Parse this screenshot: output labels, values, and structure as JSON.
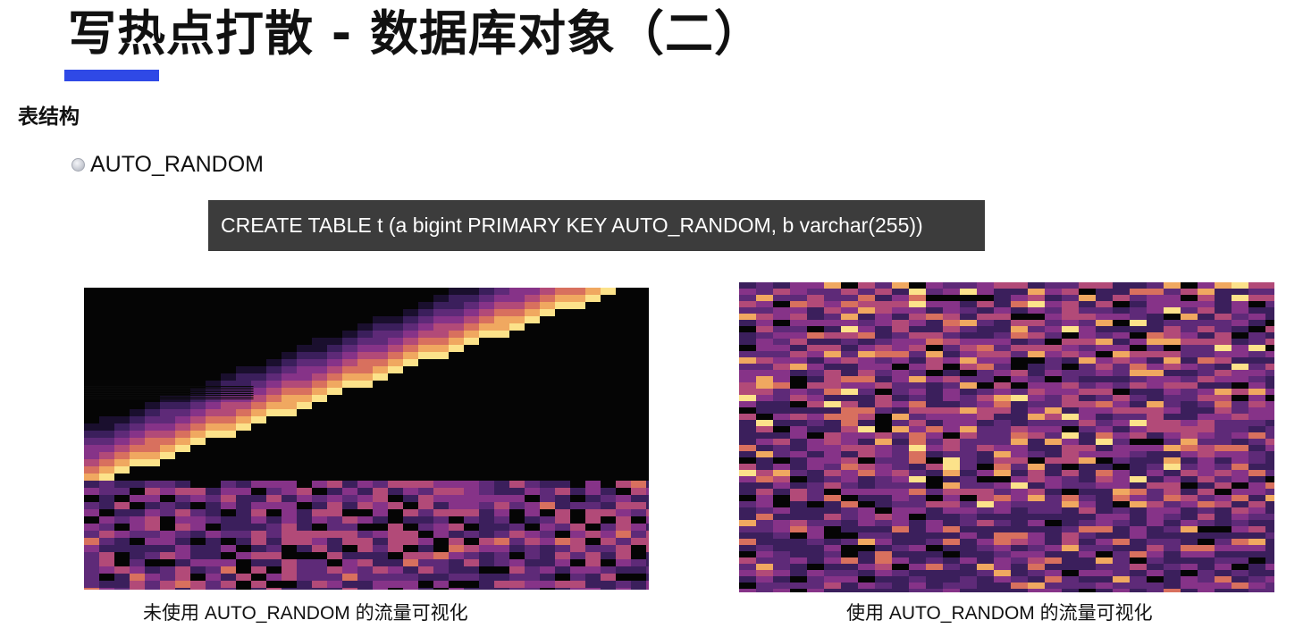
{
  "title": "写热点打散 - 数据库对象（二）",
  "section_heading": "表结构",
  "bullet": {
    "icon": "bullet-dot-icon",
    "text": "AUTO_RANDOM"
  },
  "code_example": "CREATE TABLE t (a bigint PRIMARY KEY AUTO_RANDOM, b varchar(255))",
  "figures": [
    {
      "caption": "未使用 AUTO_RANDOM 的流量可视化"
    },
    {
      "caption": "使用 AUTO_RANDOM 的流量可视化"
    }
  ],
  "colors": {
    "accent_bar": "#2f49e6",
    "code_background": "#3c3c3c",
    "heatmap_background": "#050505",
    "heatmap_palette": [
      "#1a0f2e",
      "#3b1f5c",
      "#5e2a78",
      "#863388",
      "#b24a78",
      "#d8705e",
      "#f0a860",
      "#fce28a"
    ]
  }
}
